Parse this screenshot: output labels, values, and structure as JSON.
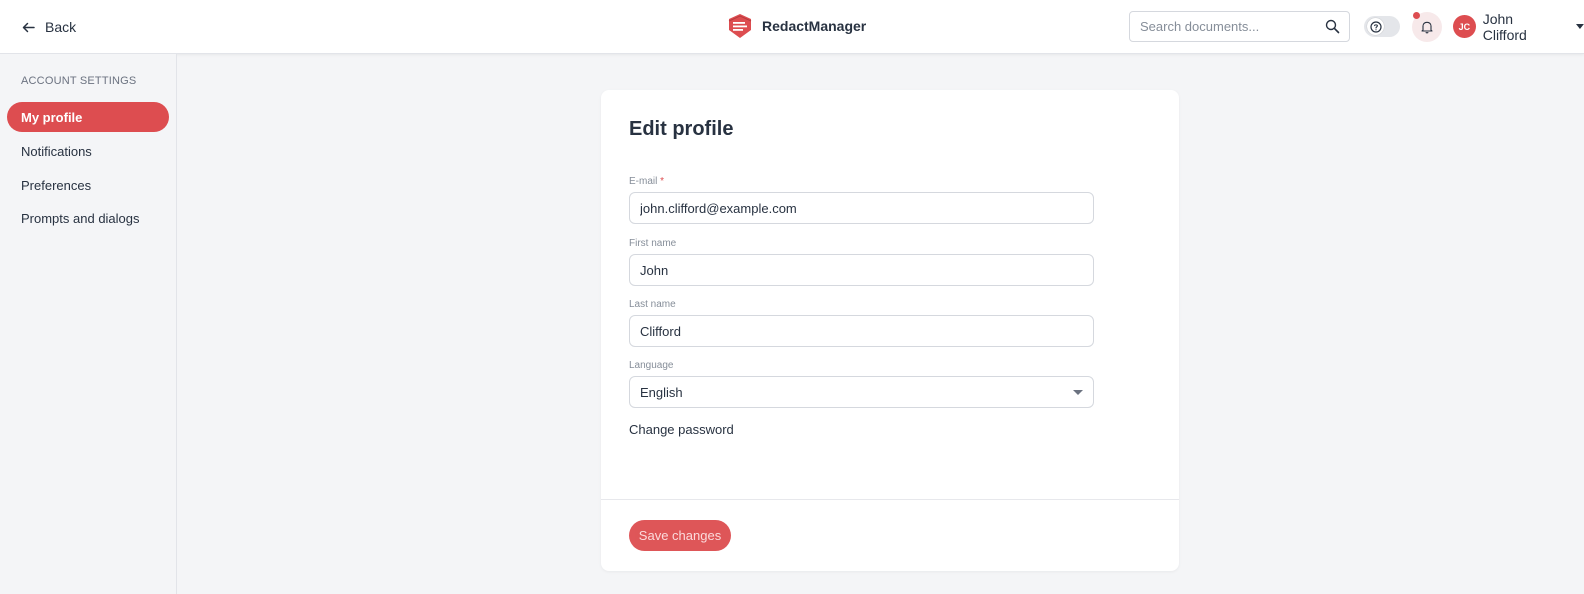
{
  "header": {
    "back_label": "Back",
    "app_name": "RedactManager",
    "search_placeholder": "Search documents...",
    "user": {
      "initials": "JC",
      "name": "John Clifford"
    },
    "has_notification": true,
    "accent_color": "#dd4d50",
    "icons": [
      "arrow-left-icon",
      "redact-logo-icon",
      "search-icon",
      "help-icon",
      "bell-icon",
      "caret-down-icon"
    ]
  },
  "sidebar": {
    "section_title": "ACCOUNT SETTINGS",
    "items": [
      {
        "label": "My profile",
        "active": true
      },
      {
        "label": "Notifications",
        "active": false
      },
      {
        "label": "Preferences",
        "active": false
      },
      {
        "label": "Prompts and dialogs",
        "active": false
      }
    ]
  },
  "form": {
    "title": "Edit profile",
    "email": {
      "label": "E-mail",
      "required_mark": "*",
      "value": "john.clifford@example.com"
    },
    "first_name": {
      "label": "First name",
      "value": "John"
    },
    "last_name": {
      "label": "Last name",
      "value": "Clifford"
    },
    "language": {
      "label": "Language",
      "value": "English"
    },
    "change_password_label": "Change password",
    "save_label": "Save changes"
  }
}
